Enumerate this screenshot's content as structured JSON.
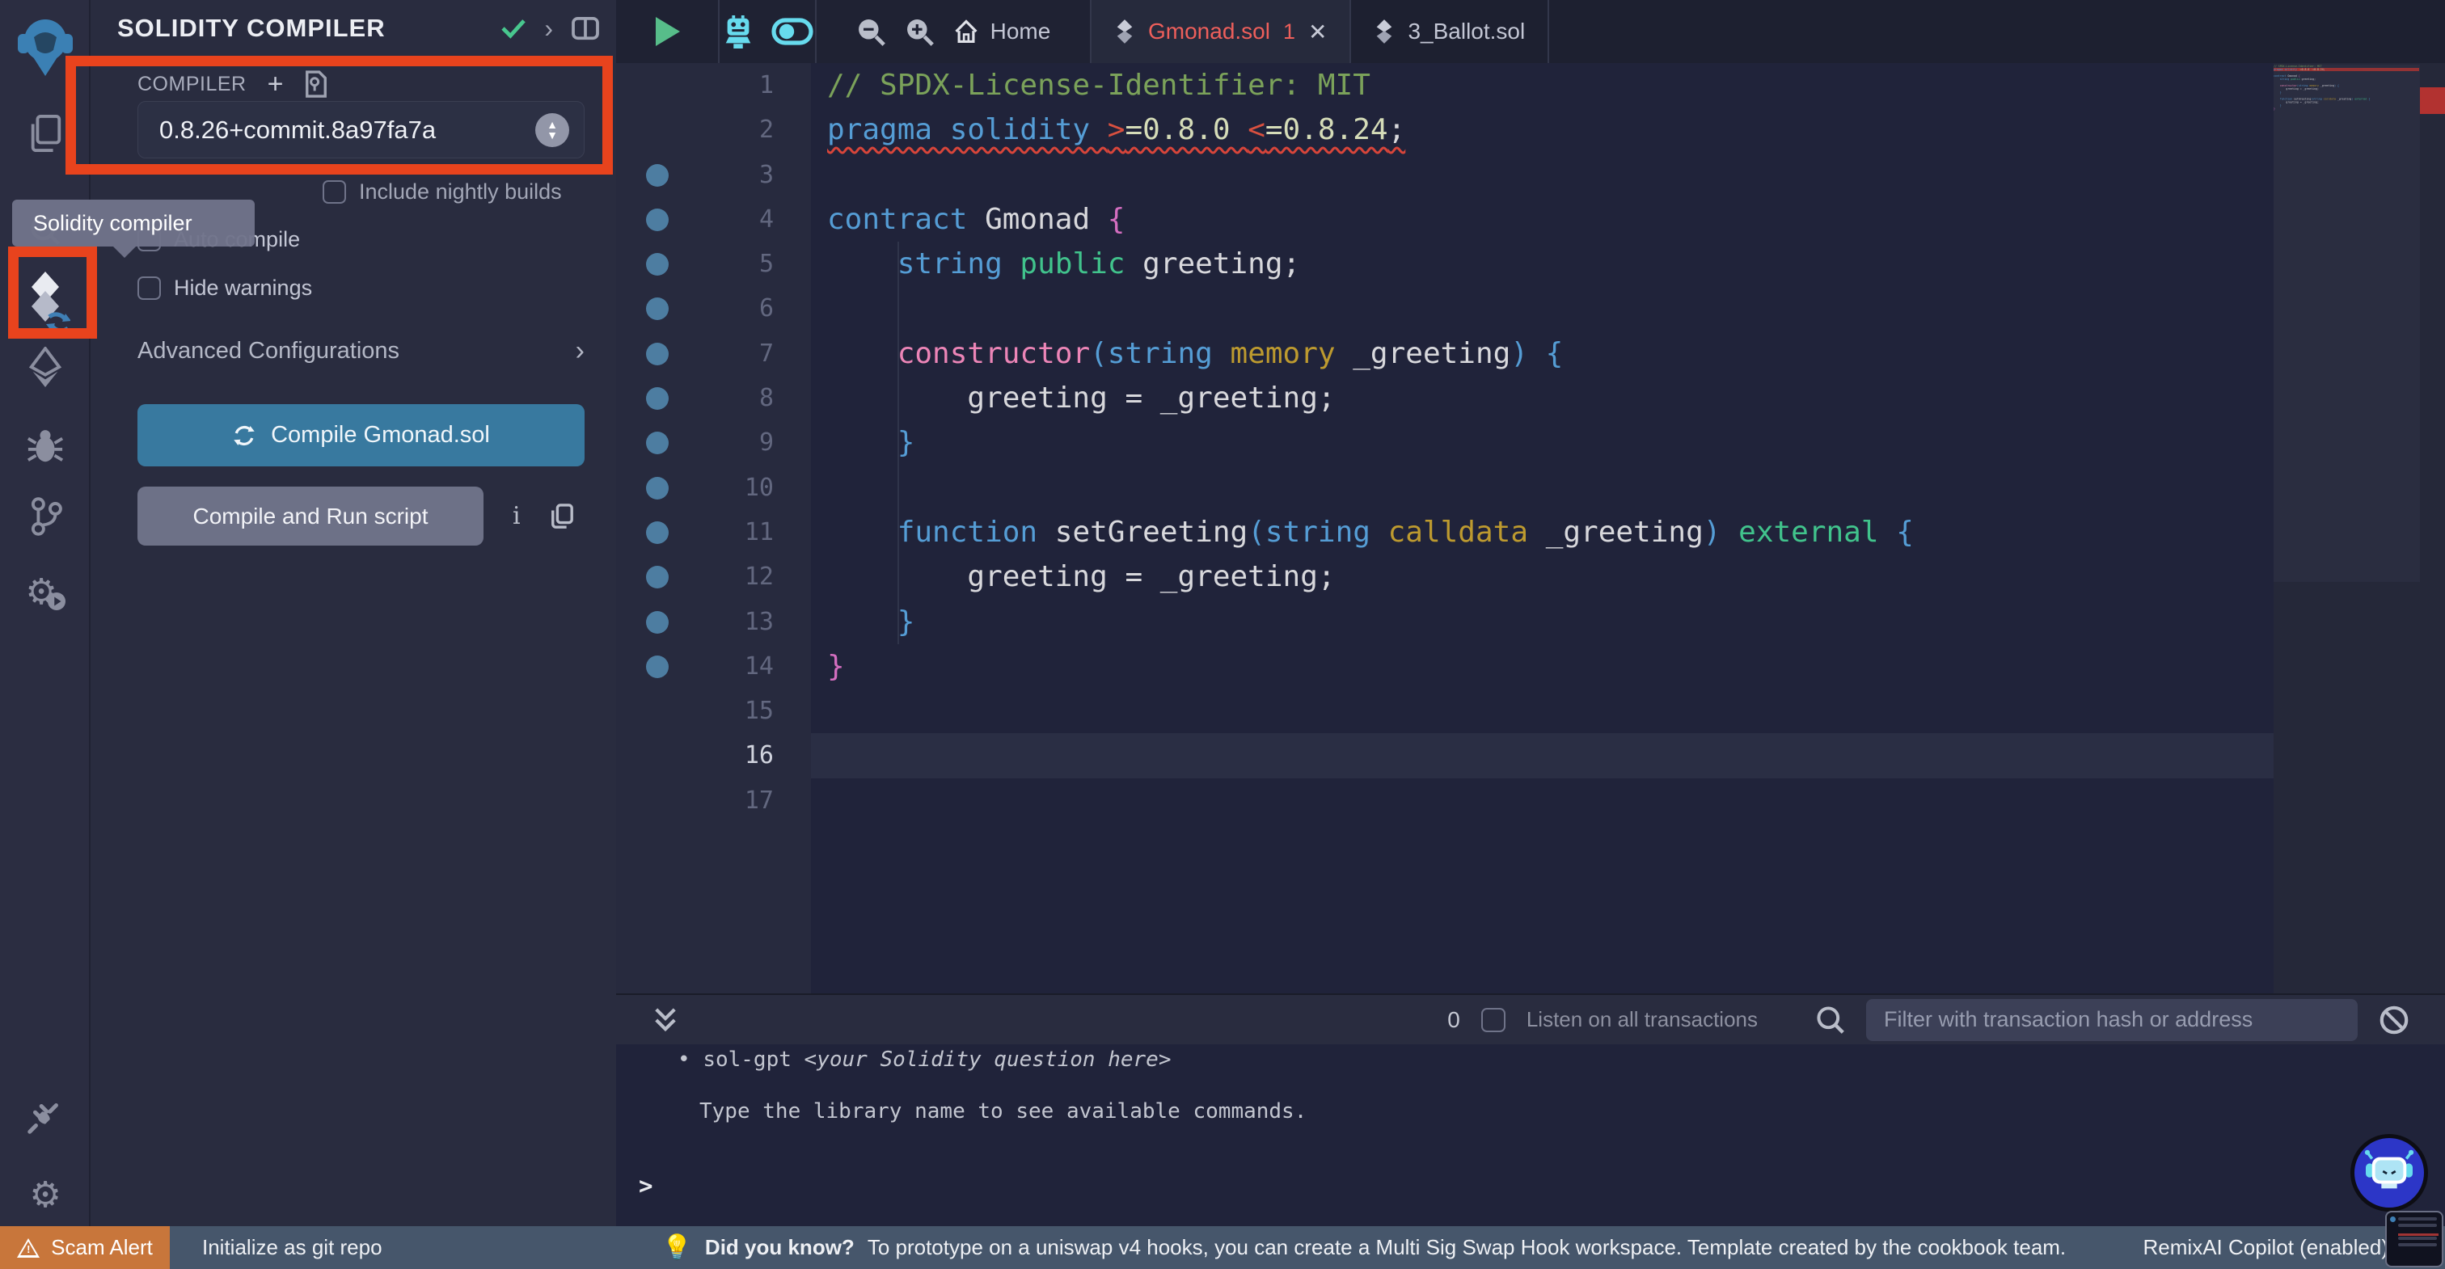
{
  "panel": {
    "title": "SOLIDITY COMPILER",
    "section_label": "COMPILER",
    "version": "0.8.26+commit.8a97fa7a",
    "nightly_label": "Include nightly builds",
    "autocompile_label": "Auto compile",
    "hide_warnings_label": "Hide warnings",
    "advanced_label": "Advanced Configurations",
    "advanced_chevron": "›",
    "compile_button": "Compile Gmonad.sol",
    "compile_run_button": "Compile and Run script"
  },
  "tooltip": {
    "text": "Solidity compiler"
  },
  "tabs": {
    "home_label": "Home",
    "active_label": "Gmonad.sol",
    "active_badge": "1",
    "close_glyph": "✕",
    "other_label": "3_Ballot.sol"
  },
  "editor": {
    "current_line": 16,
    "lines": [
      {
        "n": 1,
        "dot": false,
        "squiggle": false,
        "tokens": [
          [
            "// SPDX-License-Identifier: MIT",
            "com"
          ]
        ]
      },
      {
        "n": 2,
        "dot": false,
        "squiggle": true,
        "tokens": [
          [
            "pragma solidity ",
            "kw"
          ],
          [
            ">",
            "op"
          ],
          [
            "=0.8.0 ",
            "num"
          ],
          [
            "<",
            "op"
          ],
          [
            "=0.8.24",
            "num"
          ],
          [
            ";",
            "fg"
          ]
        ]
      },
      {
        "n": 3,
        "dot": true,
        "squiggle": false,
        "tokens": []
      },
      {
        "n": 4,
        "dot": true,
        "squiggle": false,
        "tokens": [
          [
            "contract ",
            "kw"
          ],
          [
            "Gmonad ",
            "fg"
          ],
          [
            "{",
            "b1"
          ]
        ]
      },
      {
        "n": 5,
        "dot": true,
        "squiggle": false,
        "tokens": [
          [
            "    ",
            "fg"
          ],
          [
            "string ",
            "kw"
          ],
          [
            "public ",
            "gkw"
          ],
          [
            "greeting;",
            "fg"
          ]
        ]
      },
      {
        "n": 6,
        "dot": true,
        "squiggle": false,
        "tokens": []
      },
      {
        "n": 7,
        "dot": true,
        "squiggle": false,
        "tokens": [
          [
            "    ",
            "fg"
          ],
          [
            "constructor",
            "pink"
          ],
          [
            "(",
            "b2"
          ],
          [
            "string ",
            "kw"
          ],
          [
            "memory ",
            "gold"
          ],
          [
            "_greeting",
            "fg"
          ],
          [
            ") {",
            "b2"
          ]
        ]
      },
      {
        "n": 8,
        "dot": true,
        "squiggle": false,
        "tokens": [
          [
            "        greeting = _greeting;",
            "fg"
          ]
        ]
      },
      {
        "n": 9,
        "dot": true,
        "squiggle": false,
        "tokens": [
          [
            "    ",
            "fg"
          ],
          [
            "}",
            "b2"
          ]
        ]
      },
      {
        "n": 10,
        "dot": true,
        "squiggle": false,
        "tokens": []
      },
      {
        "n": 11,
        "dot": true,
        "squiggle": false,
        "tokens": [
          [
            "    ",
            "fg"
          ],
          [
            "function ",
            "kw"
          ],
          [
            "setGreeting",
            "fg"
          ],
          [
            "(",
            "b2"
          ],
          [
            "string ",
            "kw"
          ],
          [
            "calldata ",
            "gold"
          ],
          [
            "_greeting",
            "fg"
          ],
          [
            ")",
            "b2"
          ],
          [
            " ",
            "fg"
          ],
          [
            "external ",
            "gkw"
          ],
          [
            "{",
            "b2"
          ]
        ]
      },
      {
        "n": 12,
        "dot": true,
        "squiggle": false,
        "tokens": [
          [
            "        greeting = _greeting;",
            "fg"
          ]
        ]
      },
      {
        "n": 13,
        "dot": true,
        "squiggle": false,
        "tokens": [
          [
            "    ",
            "fg"
          ],
          [
            "}",
            "b2"
          ]
        ]
      },
      {
        "n": 14,
        "dot": true,
        "squiggle": false,
        "tokens": [
          [
            "}",
            "b1"
          ]
        ]
      },
      {
        "n": 15,
        "dot": false,
        "squiggle": false,
        "tokens": []
      },
      {
        "n": 16,
        "dot": false,
        "squiggle": false,
        "tokens": []
      },
      {
        "n": 17,
        "dot": false,
        "squiggle": false,
        "tokens": []
      }
    ]
  },
  "terminal": {
    "badge": "0",
    "listen_label": "Listen on all transactions",
    "filter_placeholder": "Filter with transaction hash or address",
    "bullet": "•",
    "help_command": "sol-gpt",
    "help_hint": "<your Solidity question here>",
    "library_hint": "Type the library name to see available commands.",
    "prompt": ">"
  },
  "statusbar": {
    "scam_label": "Scam Alert",
    "git_label": "Initialize as git repo",
    "tip_title": "Did you know?",
    "tip_text": "To prototype on a uniswap v4 hooks, you can create a Multi Sig Swap Hook workspace. Template created by the cookbook team.",
    "copilot_label": "RemixAI Copilot (enabled)"
  },
  "colors": {
    "accent_blue": "#38799f",
    "annotation_red": "#e8431d",
    "error_red": "#ee5f5b",
    "cyan": "#67dbee",
    "green": "#57bd8a",
    "scam_orange": "#c8763b",
    "statusbar_slate": "#46566b"
  }
}
